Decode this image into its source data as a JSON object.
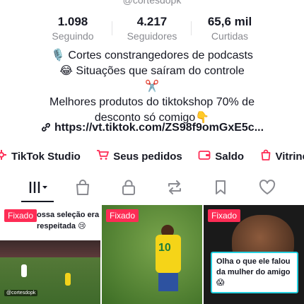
{
  "profile": {
    "handle": "@cortesdopk"
  },
  "stats": [
    {
      "value": "1.098",
      "label": "Seguindo"
    },
    {
      "value": "4.217",
      "label": "Seguidores"
    },
    {
      "value": "65,6 mil",
      "label": "Curtidas"
    }
  ],
  "bio": {
    "line1": "🎙️ Cortes constrangedores de podcasts",
    "line2": "😂 Situações que saíram do controle",
    "line3": "✂️",
    "line4": "Melhores produtos do tiktokshop 70% de",
    "line5": "desconto só comigo👇",
    "link": "https://vt.tiktok.com/ZS98f9omGxE5c..."
  },
  "actions": [
    {
      "label": "TikTok Studio",
      "icon": "tiktok-studio-icon"
    },
    {
      "label": "Seus pedidos",
      "icon": "cart-icon"
    },
    {
      "label": "Saldo",
      "icon": "wallet-icon"
    },
    {
      "label": "Vitrine",
      "icon": "shopping-bag-icon"
    }
  ],
  "tabs": [
    {
      "icon": "videos-grid-icon",
      "active": true
    },
    {
      "icon": "shop-bag-icon"
    },
    {
      "icon": "lock-icon"
    },
    {
      "icon": "repost-icon"
    },
    {
      "icon": "bookmark-icon"
    },
    {
      "icon": "heart-icon"
    }
  ],
  "videos": [
    {
      "pinned_label": "Fixado",
      "caption": "ossa seleção era respeitada 😢",
      "tag": "@cortesdopk"
    },
    {
      "pinned_label": "Fixado",
      "jersey_number": "10"
    },
    {
      "pinned_label": "Fixado",
      "caption": "Olha o que ele falou da mulher do amigo 😱"
    }
  ],
  "colors": {
    "accent": "#fe2c55",
    "text": "#161823",
    "muted": "#8a8b91",
    "caption_border": "#25d0e0"
  }
}
